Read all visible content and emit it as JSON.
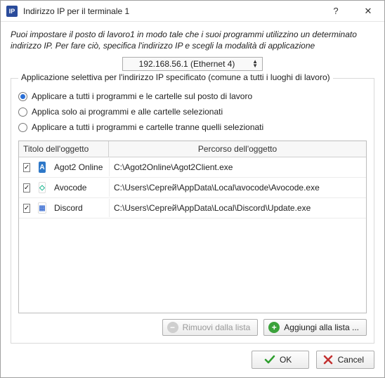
{
  "titlebar": {
    "app_icon_text": "IP",
    "title": "Indirizzo IP per il terminale 1"
  },
  "intro": "Puoi impostare il posto di lavoro1 in modo tale che i suoi programmi utilizzino un determinato indirizzo IP. Per fare ciò, specifica l'indirizzo IP e scegli la modalità di applicazione",
  "ip_selector": {
    "value": "192.168.56.1 (Ethernet 4)"
  },
  "groupbox": {
    "title": "Applicazione selettiva per l'indirizzo IP specificato (comune a tutti i luoghi di lavoro)",
    "options": [
      {
        "label": "Applicare a tutti i programmi e le cartelle sul posto di lavoro",
        "selected": true
      },
      {
        "label": "Applica solo ai programmi e alle cartelle selezionati",
        "selected": false
      },
      {
        "label": "Applicare a tutti i programmi e cartelle tranne quelli selezionati",
        "selected": false
      }
    ],
    "columns": {
      "title": "Titolo dell'oggetto",
      "path": "Percorso dell'oggetto"
    },
    "rows": [
      {
        "checked": true,
        "icon_bg": "#2e78c8",
        "icon_text": "A",
        "title": "Agot2 Online",
        "path": "C:\\Agot2Online\\Agot2Client.exe"
      },
      {
        "checked": true,
        "icon_bg": "#ffffff",
        "icon_text": "◇",
        "icon_color": "#13b38b",
        "title": "Avocode",
        "path": "C:\\Users\\Сергей\\AppData\\Local\\avocode\\Avocode.exe"
      },
      {
        "checked": true,
        "icon_bg": "#ffffff",
        "icon_text": "▦",
        "icon_color": "#4d7bd6",
        "title": "Discord",
        "path": "C:\\Users\\Сергей\\AppData\\Local\\Discord\\Update.exe"
      }
    ],
    "buttons": {
      "remove": "Rimuovi dalla lista",
      "add": "Aggiungi alla lista ..."
    }
  },
  "footer": {
    "ok": "OK",
    "cancel": "Cancel"
  }
}
